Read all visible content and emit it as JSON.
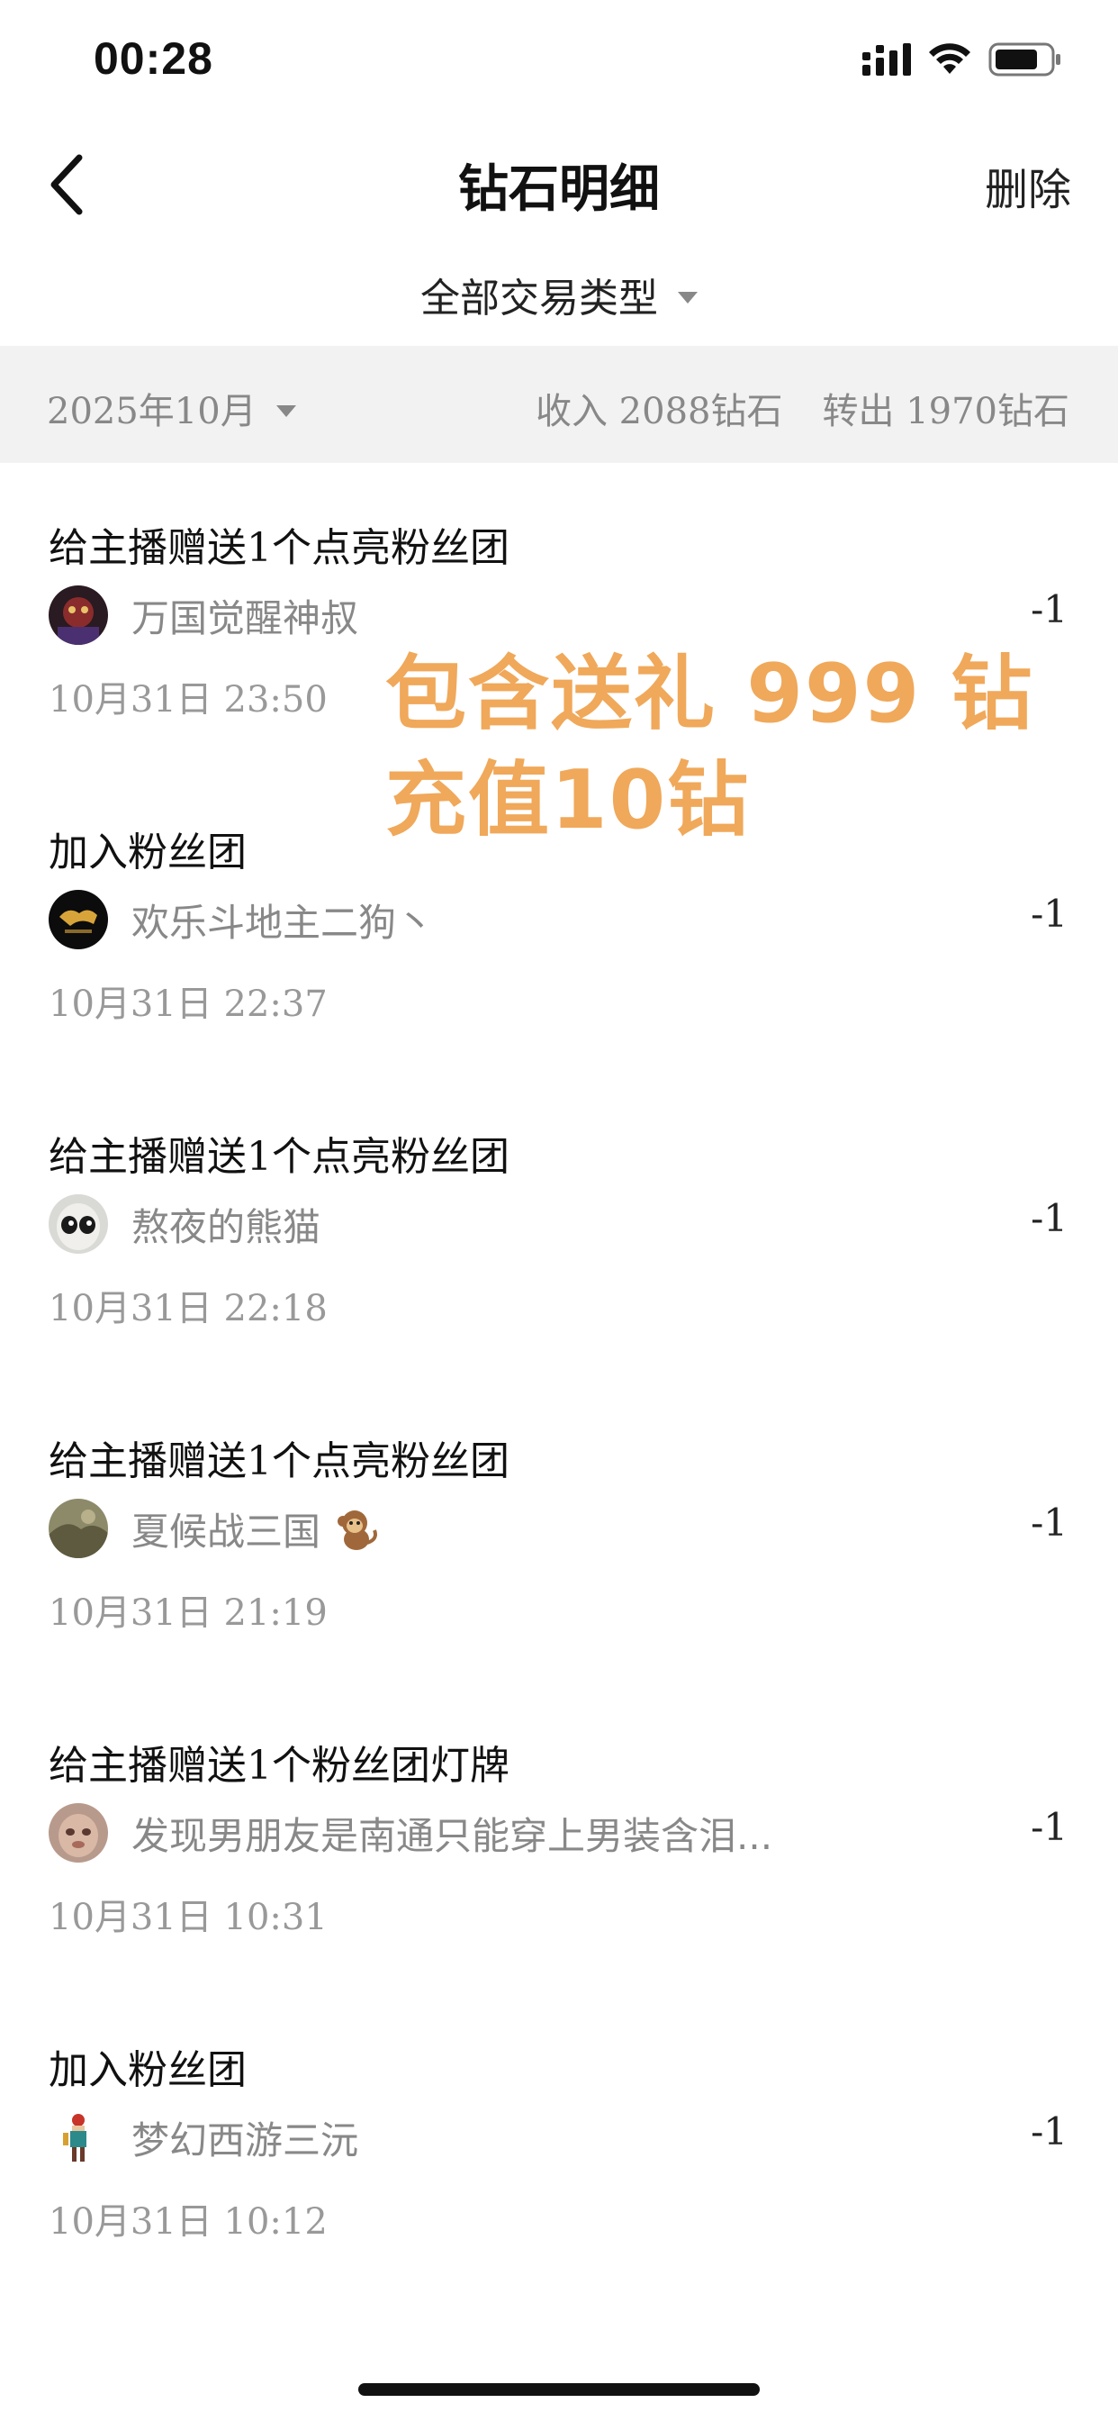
{
  "status_bar": {
    "time": "00:28"
  },
  "nav": {
    "title": "钻石明细",
    "delete_label": "删除"
  },
  "filter": {
    "type_label": "全部交易类型"
  },
  "summary": {
    "month": "2025年10月",
    "income": "收入 2088钻石",
    "transfer_out": "转出 1970钻石"
  },
  "overlay": {
    "line1": "包含送礼 999 钻",
    "line2": "充值10钻"
  },
  "transactions": [
    {
      "title": "给主播赠送1个点亮粉丝团",
      "user": "万国觉醒神叔",
      "amount": "-1",
      "time": "10月31日 23:50"
    },
    {
      "title": "加入粉丝团",
      "user": "欢乐斗地主二狗丶",
      "amount": "-1",
      "time": "10月31日 22:37"
    },
    {
      "title": "给主播赠送1个点亮粉丝团",
      "user": "熬夜的熊猫",
      "amount": "-1",
      "time": "10月31日 22:18"
    },
    {
      "title": "给主播赠送1个点亮粉丝团",
      "user": "夏候战三国",
      "amount": "-1",
      "time": "10月31日 21:19"
    },
    {
      "title": "给主播赠送1个粉丝团灯牌",
      "user": "发现男朋友是南通只能穿上男装含泪...",
      "amount": "-1",
      "time": "10月31日 10:31"
    },
    {
      "title": "加入粉丝团",
      "user": "梦幻西游三沅",
      "amount": "-1",
      "time": "10月31日 10:12"
    }
  ]
}
